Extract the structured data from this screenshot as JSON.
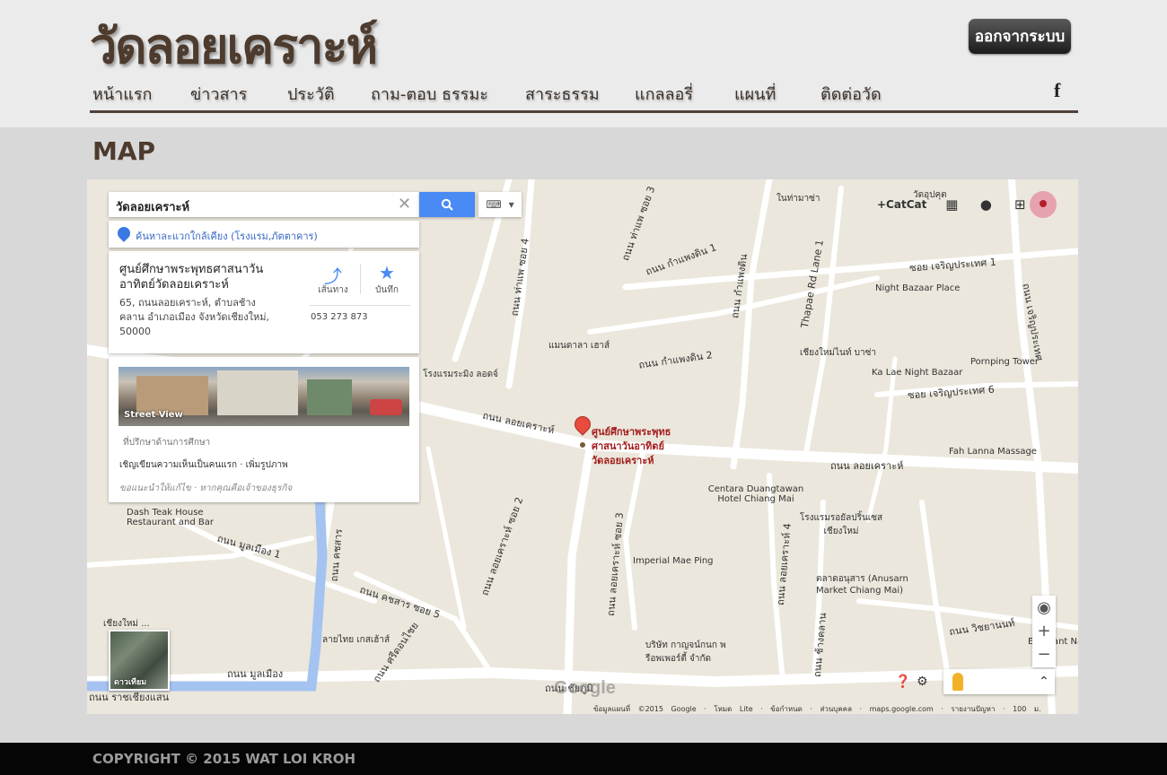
{
  "header": {
    "site_title": "วัดลอยเคราะห์",
    "logout_label": "ออกจากระบบ",
    "nav": [
      {
        "label": "หน้าแรก"
      },
      {
        "label": "ข่าวสาร"
      },
      {
        "label": "ประวัติ"
      },
      {
        "label": "ถาม-ตอบ ธรรมะ"
      },
      {
        "label": "สาระธรรม"
      },
      {
        "label": "แกลลอรี่"
      },
      {
        "label": "แผนที่"
      },
      {
        "label": "ติดต่อวัด"
      }
    ],
    "social_icon": "facebook-icon"
  },
  "main": {
    "section_title": "MAP"
  },
  "map": {
    "search_value": "วัดลอยเคราะห์",
    "nearby_link": "ค้นหาละแวกใกล้เคียง (โรงแรม,ภัตตาคาร)",
    "place": {
      "name": "ศูนย์ศึกษาพระพุทธศาสนาวันอาทิตย์วัดลอยเคราะห์",
      "address": "65, ถนนลอยเคราะห์, ตำบลช้างคลาน อำเภอเมือง จังหวัดเชียงใหม่, 50000",
      "directions_label": "เส้นทาง",
      "save_label": "บันทึก",
      "phone": "053 273 873"
    },
    "photo_card": {
      "street_view_label": "Street View",
      "category": "ที่ปรึกษาด้านการศึกษา",
      "review_prompt": "เชิญเขียนความเห็นเป็นคนแรก · เพิ่มรูปภาพ",
      "suggest": "ขอแนะนำให้แก้ไข · หากคุณคือเจ้าของธุรกิจ"
    },
    "top_controls": {
      "catcat": "+CatCat"
    },
    "pin_label": [
      "ศูนย์ศึกษาพระพุทธ",
      "ศาสนาวันอาทิตย์",
      "วัดลอยเคราะห์"
    ],
    "labels": [
      {
        "text": "ในท่ามาซ่า"
      },
      {
        "text": "วัดอุปคุต"
      },
      {
        "text": "Night Bazaar Place"
      },
      {
        "text": "Pornping Tower"
      },
      {
        "text": "Ka Lae Night Bazaar"
      },
      {
        "text": "เชียงใหม่ไนท์ บาซ่า"
      },
      {
        "text": "Fah Lanna Massage"
      },
      {
        "text": "Centara Duangtawan Hotel Chiang Mai"
      },
      {
        "text": "โรงแรมรอยัลปริ้นเซส เชียงใหม่"
      },
      {
        "text": "ตลาดอนุสาร (Anusarn Market Chiang Mai)"
      },
      {
        "text": "Imperial Mae Ping"
      },
      {
        "text": "Dash Teak House Restaurant and Bar"
      },
      {
        "text": "แมนดาลา เฮาส์"
      },
      {
        "text": "โรงแรมระมิง ลอดจ์"
      },
      {
        "text": "ลายไทย เกสเฮ้าส์"
      },
      {
        "text": "บริษัท กาญจน์กนก พ รือพเพอร์ตี้ จำกัด"
      },
      {
        "text": "เชียงใหม่ ..."
      },
      {
        "text": "Elephant Nature"
      }
    ],
    "roads": [
      {
        "text": "ถนน ลอยเคราะห์"
      },
      {
        "text": "ถนน ลอยเคราะห์"
      },
      {
        "text": "ถนน ท่าแพ ซอย 4"
      },
      {
        "text": "ถนน ท่าแพ ซอย 3"
      },
      {
        "text": "ถนน กำแพงดิน 1"
      },
      {
        "text": "ถนน กำแพงดิน"
      },
      {
        "text": "ถนน กำแพงดิน 2"
      },
      {
        "text": "Thapae Rd Lane 1"
      },
      {
        "text": "ซอย เจริญประเทศ 1"
      },
      {
        "text": "ซอย เจริญประเทศ 6"
      },
      {
        "text": "ถนน เจริญประเทศ"
      },
      {
        "text": "ถนน มูลเมือง"
      },
      {
        "text": "ถนน มูลเมือง 1"
      },
      {
        "text": "ถนน คชสาร"
      },
      {
        "text": "ถนน คชสาร ซอย 5"
      },
      {
        "text": "ถนน ช้างคลาน"
      },
      {
        "text": "ถนน ศรีดอนไชย"
      },
      {
        "text": "ถนน ลอยเคราะห์ ซอย 3"
      },
      {
        "text": "ถนน ลอยเคราะห์ 4"
      },
      {
        "text": "ถนน ลอยเคราะห์ ซอย 2"
      },
      {
        "text": "ถนน ชัยภูมิ"
      },
      {
        "text": "ถนน วิชยานนท์"
      },
      {
        "text": "ถนน ราชเชียงแสน"
      }
    ],
    "satellite_label": "ดาวเทียม",
    "google_logo": "Google",
    "attribution": "ข้อมูลแผนที่ ©2015 Google · โหมด Lite · ข้อกำหนด · ส่วนบุคคล · maps.google.com · รายงานปัญหา · 100 ม."
  },
  "footer": {
    "copyright": "COPYRIGHT © 2015 WAT LOI KROH"
  }
}
